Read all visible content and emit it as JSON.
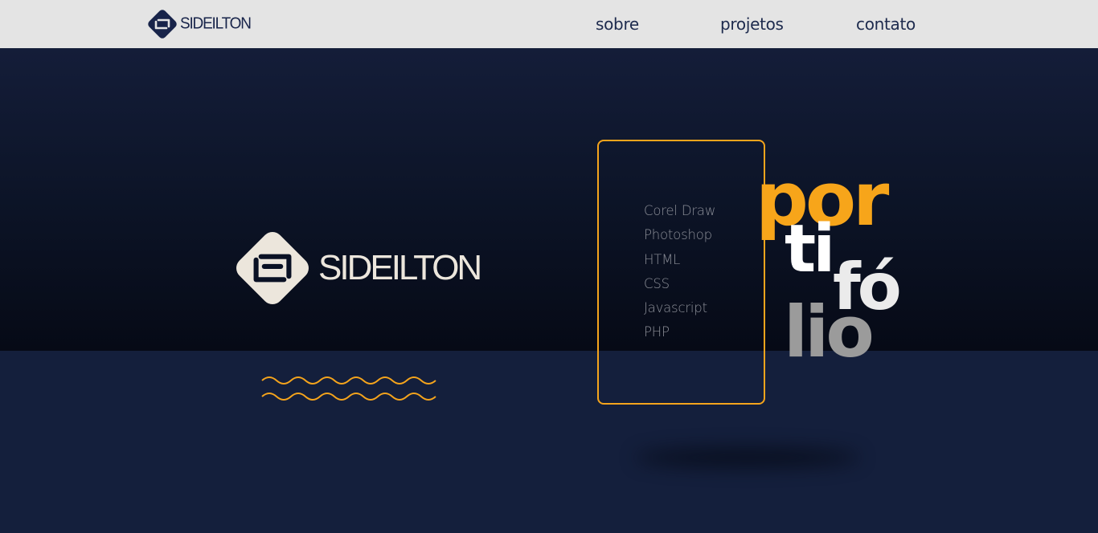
{
  "header": {
    "logo_text": "SIDEILTON",
    "nav": {
      "sobre": "sobre",
      "projetos": "projetos",
      "contato": "contato"
    }
  },
  "hero": {
    "logo_text": "SIDEILTON",
    "skills": [
      "Corel Draw",
      "Photoshop",
      "HTML",
      "CSS",
      "Javascript",
      "PHP"
    ],
    "portfolio_word": {
      "part1": "por",
      "part2": "ti",
      "part3": "fó",
      "part4": "lio"
    }
  },
  "colors": {
    "header_bg": "#e4e4e4",
    "navy": "#141f3c",
    "accent": "#f7a51a",
    "logo_cream": "#ece6dc"
  }
}
